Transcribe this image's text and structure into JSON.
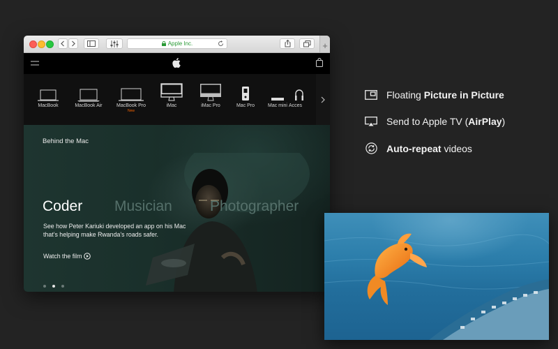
{
  "browser": {
    "address": "Apple Inc.",
    "products": [
      {
        "label": "MacBook",
        "icon": "macbook-icon"
      },
      {
        "label": "MacBook Air",
        "icon": "macbook-air-icon"
      },
      {
        "label": "MacBook Pro",
        "icon": "macbook-pro-icon",
        "badge": "New"
      },
      {
        "label": "iMac",
        "icon": "imac-icon"
      },
      {
        "label": "iMac Pro",
        "icon": "imac-pro-icon"
      },
      {
        "label": "Mac Pro",
        "icon": "mac-pro-icon"
      },
      {
        "label": "Mac mini",
        "icon": "mac-mini-icon"
      },
      {
        "label": "Acces",
        "icon": "accessories-icon"
      }
    ],
    "hero": {
      "eyebrow": "Behind the Mac",
      "roles": [
        "Coder",
        "Musician",
        "Photographer"
      ],
      "description": "See how Peter Kariuki developed an app on his Mac that’s helping make Rwanda’s roads safer.",
      "cta": "Watch the film"
    }
  },
  "features": [
    {
      "icon": "picture-in-picture-icon",
      "pre": "Floating ",
      "bold": "Picture in Picture",
      "post": ""
    },
    {
      "icon": "airplay-icon",
      "pre": "Send to Apple TV (",
      "bold": "AirPlay",
      "post": ")"
    },
    {
      "icon": "repeat-icon",
      "pre": "",
      "bold": "Auto-repeat",
      "post": " videos"
    }
  ],
  "colors": {
    "accent_green": "#2a9a36",
    "badge_orange": "#f56300",
    "background": "#232323"
  }
}
